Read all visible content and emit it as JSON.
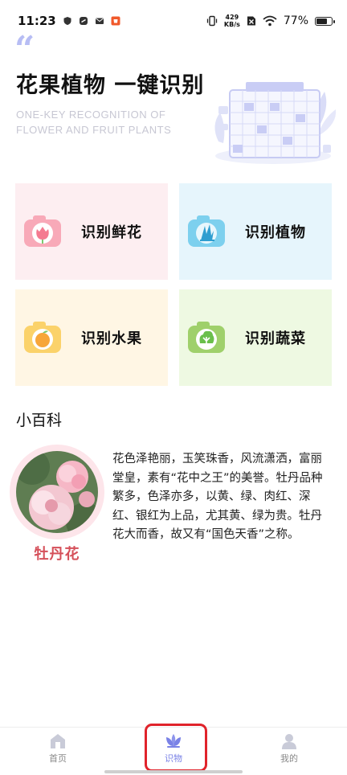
{
  "status_bar": {
    "time": "11:23",
    "net_speed_value": "429",
    "net_speed_unit": "KB/s",
    "battery_percent": "77%",
    "battery_level": 0.77
  },
  "hero": {
    "title": "花果植物 一键识别",
    "subtitle_line1": "ONE-KEY RECOGNITION OF",
    "subtitle_line2": "FLOWER AND FRUIT PLANTS"
  },
  "features": [
    {
      "label": "识别鲜花",
      "bg": "#fdeef1",
      "icon": "flower-camera-icon",
      "cam_color": "#f8a9b8"
    },
    {
      "label": "识别植物",
      "bg": "#e6f5fc",
      "icon": "plant-camera-icon",
      "cam_color": "#7dd0ee"
    },
    {
      "label": "识别水果",
      "bg": "#fff6e4",
      "icon": "fruit-camera-icon",
      "cam_color": "#fbd26a"
    },
    {
      "label": "识别蔬菜",
      "bg": "#eef9e2",
      "icon": "vegetable-camera-icon",
      "cam_color": "#9fd06b"
    }
  ],
  "encyclopedia": {
    "section_title": "小百科",
    "plant_name": "牡丹花",
    "description": "花色泽艳丽，玉笑珠香，风流潇洒，富丽堂皇，素有“花中之王”的美誉。牡丹品种繁多，色泽亦多，以黄、绿、肉红、深红、银红为上品，尤其黄、绿为贵。牡丹花大而香，故又有“国色天香”之称。"
  },
  "bottom_nav": {
    "items": [
      {
        "label": "首页",
        "icon": "home-icon",
        "active": false
      },
      {
        "label": "识物",
        "icon": "lotus-icon",
        "active": true
      },
      {
        "label": "我的",
        "icon": "user-icon",
        "active": false
      }
    ]
  },
  "colors": {
    "accent": "#7a82e6",
    "highlight_box": "#e0232b",
    "plant_name": "#d5505a"
  }
}
